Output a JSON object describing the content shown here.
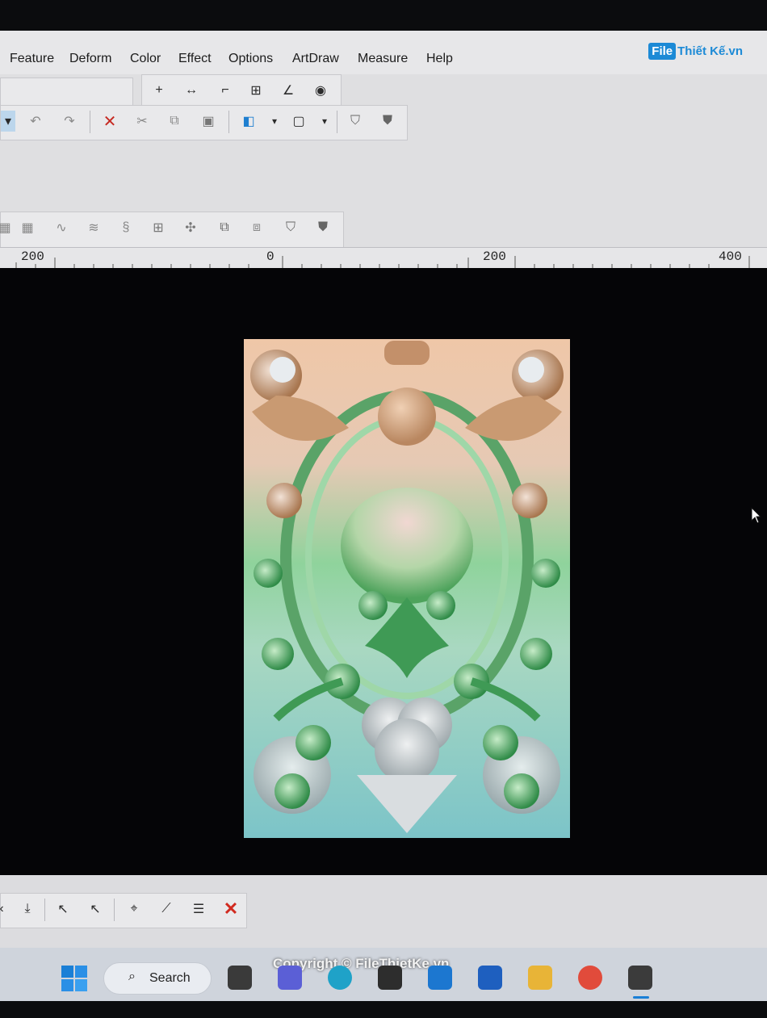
{
  "menu": [
    "Feature",
    "Deform",
    "Color",
    "Effect",
    "Options",
    "ArtDraw",
    "Measure",
    "Help"
  ],
  "watermark": {
    "file": "File",
    "rest": "Thiết Kế.vn"
  },
  "ruler": {
    "labels": [
      "200",
      "0",
      "200",
      "400"
    ]
  },
  "taskbar": {
    "search_label": "Search",
    "copyright": "Copyright © FileThietKe.vn"
  },
  "colors": {
    "accent": "#1c8ad6",
    "delete": "#d12a1f"
  }
}
